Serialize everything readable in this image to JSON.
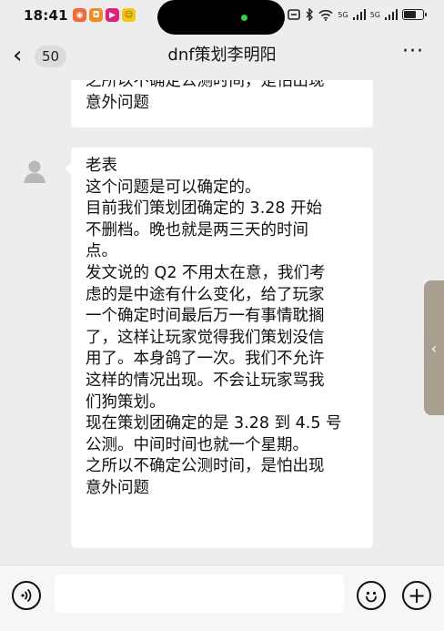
{
  "status_bar": {
    "time": "18:41",
    "app_icons": [
      {
        "icon": "app-notification-icon",
        "color": "#ef6c3a",
        "glyph": "◉"
      },
      {
        "icon": "app-store-icon",
        "color": "#f08a24",
        "glyph": "◘"
      },
      {
        "icon": "app-video-icon",
        "color": "#e0207a",
        "glyph": "▶"
      },
      {
        "icon": "app-game-icon",
        "color": "#f5c518",
        "glyph": "☺"
      }
    ],
    "signal_1_label": "5G",
    "signal_2_label": "5G",
    "battery_level": 0.6
  },
  "nav": {
    "back_count": "50",
    "title": "dnf策划李明阳",
    "more_label": "···"
  },
  "messages": [
    {
      "lines": [
        "之所以不确定公测时间，是怕出现",
        "意外问题"
      ]
    },
    {
      "lines": [
        "老表",
        "这个问题是可以确定的。",
        "目前我们策划团确定的 3.28 开始",
        "不删档。晚也就是两三天的时间",
        "点。",
        "发文说的 Q2 不用太在意，我们考",
        "虑的是中途有什么变化，给了玩家",
        "一个确定时间最后万一有事情耽搁",
        "了，这样让玩家觉得我们策划没信",
        "用了。本身鸽了一次。我们不允许",
        "这样的情况出现。不会让玩家骂我",
        "们狗策划。",
        "现在策划团确定的是 3.28 到 4.5 号",
        "公测。中间时间也就一个星期。",
        "之所以不确定公测时间，是怕出现",
        "意外问题"
      ]
    }
  ],
  "side_tab": {
    "label": "‹"
  },
  "input_bar": {
    "placeholder": "",
    "plus_label": "+"
  }
}
